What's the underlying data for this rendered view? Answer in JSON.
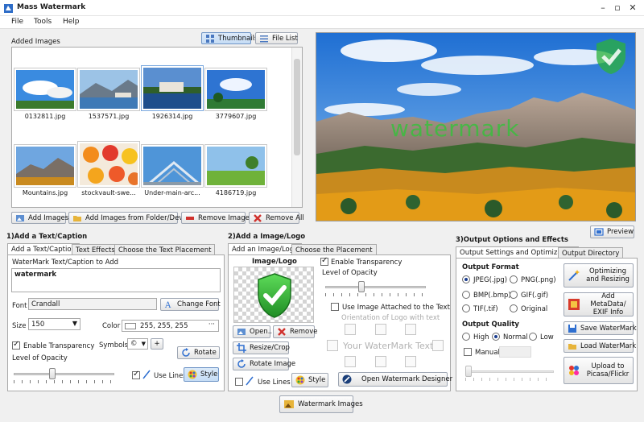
{
  "app": {
    "title": "Mass Watermark"
  },
  "menu": [
    "File",
    "Tools",
    "Help"
  ],
  "added_images": {
    "label": "Added Images",
    "view_thumbnails": "Thumbnails",
    "view_filelist": "File List",
    "items": [
      {
        "name": "0132811.jpg"
      },
      {
        "name": "1537571.jpg"
      },
      {
        "name": "1926314.jpg"
      },
      {
        "name": "3779607.jpg"
      },
      {
        "name": "Mountains.jpg"
      },
      {
        "name": "stockvault-swe..."
      },
      {
        "name": "Under-main-arc..."
      },
      {
        "name": "4186719.jpg"
      }
    ],
    "add_images": "Add Images",
    "add_folder": "Add Images from Folder/Device",
    "remove_image": "Remove Image",
    "remove_all": "Remove All"
  },
  "preview": {
    "watermark_text": "watermark",
    "button": "Preview"
  },
  "section1": {
    "title": "1)Add a Text/Caption",
    "tabs": [
      "Add a Text/Caption",
      "Text Effects",
      "Choose the Text Placement"
    ],
    "caption_label": "WaterMark Text/Caption to Add",
    "caption_value": "watermark",
    "font_label": "Font",
    "font_value": "Crandall",
    "change_font": "Change Font",
    "size_label": "Size",
    "size_value": "150",
    "color_label": "Color",
    "color_value": "255, 255, 255",
    "enable_transparency": "Enable Transparency",
    "symbols_label": "Symbols",
    "symbols_value": "©",
    "plus": "+",
    "opacity_label": "Level of Opacity",
    "opacity_level": 0.38,
    "rotate": "Rotate",
    "use_lines": "Use Lines",
    "style": "Style"
  },
  "section2": {
    "title": "2)Add a Image/Logo",
    "tabs": [
      "Add an Image/Logo",
      "Choose the Placement"
    ],
    "image_label": "Image/Logo",
    "open": "Open..",
    "remove": "Remove",
    "resize_crop": "Resize/Crop",
    "rotate_image": "Rotate Image",
    "use_lines": "Use Lines",
    "style": "Style",
    "enable_transparency": "Enable Transparency",
    "opacity_label": "Level of Opacity",
    "opacity_level": 0.35,
    "attached_text": "Use Image Attached to the Text",
    "orientation_label": "Orientation of Logo with text",
    "placeholder_text": "Your WaterMark Text",
    "designer": "Open Watermark Designer"
  },
  "section3": {
    "title": "3)Output Options and Effects",
    "tabs": [
      "Output Settings and Optimization",
      "Output Directory"
    ],
    "format_label": "Output Format",
    "formats": [
      "JPEG(.jpg)",
      "PNG(.png)",
      "BMP(.bmp)",
      "GIF(.gif)",
      "TIF(.tif)",
      "Original"
    ],
    "quality_label": "Output Quality",
    "qualities": [
      "High",
      "Normal",
      "Low"
    ],
    "manual": "Manual",
    "optimizing": "Optimizing and Resizing",
    "add_metadata": "Add MetaData/ EXIF Info",
    "save_watermark": "Save WaterMark",
    "load_watermark": "Load WaterMark",
    "upload": "Upload to Picasa/Flickr"
  },
  "watermark_images": "Watermark Images",
  "colors": {
    "accent": "#2f6fd0",
    "watermark_green": "#35c23a",
    "shield": "#1f9a2a"
  }
}
